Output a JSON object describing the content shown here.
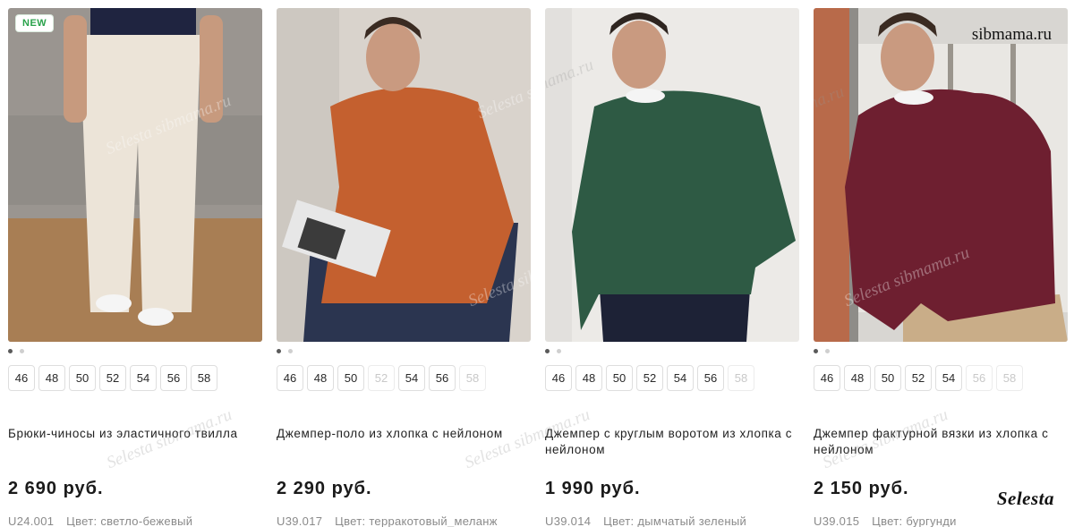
{
  "watermark": {
    "site": "sibmama.ru",
    "brand": "Selesta",
    "faint": "Selesta sibmama.ru"
  },
  "products": [
    {
      "badge": "NEW",
      "image_alt": "Брюки-чиносы светло-бежевые",
      "colors": {
        "bg": "#9a9590",
        "floor": "#a87e54",
        "top": "#1f2440",
        "garment": "#ece4d8",
        "skin": "#c79a7e",
        "hair": "#3a2b22"
      },
      "sizes": [
        {
          "label": "46",
          "available": true
        },
        {
          "label": "48",
          "available": true
        },
        {
          "label": "50",
          "available": true
        },
        {
          "label": "52",
          "available": true
        },
        {
          "label": "54",
          "available": true
        },
        {
          "label": "56",
          "available": true
        },
        {
          "label": "58",
          "available": true
        }
      ],
      "title": "Брюки-чиносы из эластичного твилла",
      "price": "2 690 руб.",
      "sku": "U24.001",
      "color_text": "Цвет: светло-бежевый"
    },
    {
      "badge": "",
      "image_alt": "Джемпер-поло терракотовый",
      "colors": {
        "bg": "#d9d3cc",
        "floor": "#c8bfb6",
        "top": "#c4602f",
        "garment": "#2b3550",
        "skin": "#c99a80",
        "hair": "#3a2b22"
      },
      "sizes": [
        {
          "label": "46",
          "available": true
        },
        {
          "label": "48",
          "available": true
        },
        {
          "label": "50",
          "available": true
        },
        {
          "label": "52",
          "available": false
        },
        {
          "label": "54",
          "available": true
        },
        {
          "label": "56",
          "available": true
        },
        {
          "label": "58",
          "available": false
        }
      ],
      "title": "Джемпер-поло из хлопка с нейлоном",
      "price": "2 290 руб.",
      "sku": "U39.017",
      "color_text": "Цвет: терракотовый_меланж"
    },
    {
      "badge": "",
      "image_alt": "Джемпер с круглым воротом зеленый",
      "colors": {
        "bg": "#eceae7",
        "floor": "#e2dfdb",
        "top": "#2e5a44",
        "garment": "#1d2236",
        "skin": "#c99a80",
        "hair": "#2e2520"
      },
      "sizes": [
        {
          "label": "46",
          "available": true
        },
        {
          "label": "48",
          "available": true
        },
        {
          "label": "50",
          "available": true
        },
        {
          "label": "52",
          "available": true
        },
        {
          "label": "54",
          "available": true
        },
        {
          "label": "56",
          "available": true
        },
        {
          "label": "58",
          "available": false
        }
      ],
      "title": "Джемпер с круглым воротом из хлопка с нейлоном",
      "price": "1 990 руб.",
      "sku": "U39.014",
      "color_text": "Цвет: дымчатый зеленый"
    },
    {
      "badge": "",
      "image_alt": "Джемпер фактурной вязки бургунди",
      "colors": {
        "bg": "#d8d6d2",
        "floor": "#b7a58a",
        "top": "#6e1f30",
        "garment": "#c9ad88",
        "skin": "#c99a80",
        "hair": "#3a2b22"
      },
      "sizes": [
        {
          "label": "46",
          "available": true
        },
        {
          "label": "48",
          "available": true
        },
        {
          "label": "50",
          "available": true
        },
        {
          "label": "52",
          "available": true
        },
        {
          "label": "54",
          "available": true
        },
        {
          "label": "56",
          "available": false
        },
        {
          "label": "58",
          "available": false
        }
      ],
      "title": "Джемпер фактурной вязки из хлопка с нейлоном",
      "price": "2 150 руб.",
      "sku": "U39.015",
      "color_text": "Цвет: бургунди"
    }
  ]
}
